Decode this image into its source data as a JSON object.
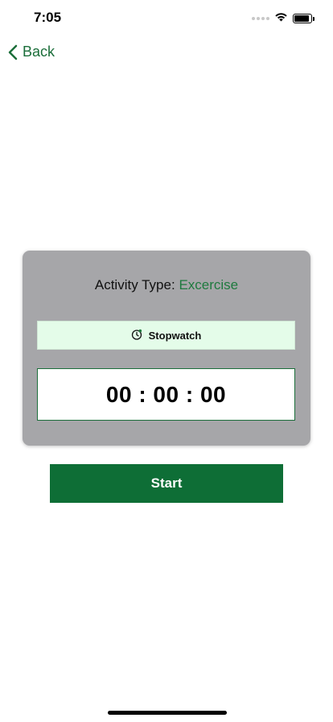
{
  "status_bar": {
    "time": "7:05",
    "icons": [
      "signal-dots-icon",
      "wifi-icon",
      "battery-icon"
    ]
  },
  "nav": {
    "back_label": "Back",
    "back_icon": "chevron-left-icon"
  },
  "card": {
    "activity_label": "Activity Type:",
    "activity_value": "Excercise",
    "mode_label": "Stopwatch",
    "mode_icon": "stopwatch-icon",
    "timer": {
      "hours": "00",
      "minutes": "00",
      "seconds": "00",
      "separator": ":"
    }
  },
  "actions": {
    "start_label": "Start"
  },
  "colors": {
    "accent_green": "#1b6e3a",
    "button_green": "#0e6e36",
    "card_gray": "#a6a6a9",
    "mode_bg": "#e4fce9"
  }
}
